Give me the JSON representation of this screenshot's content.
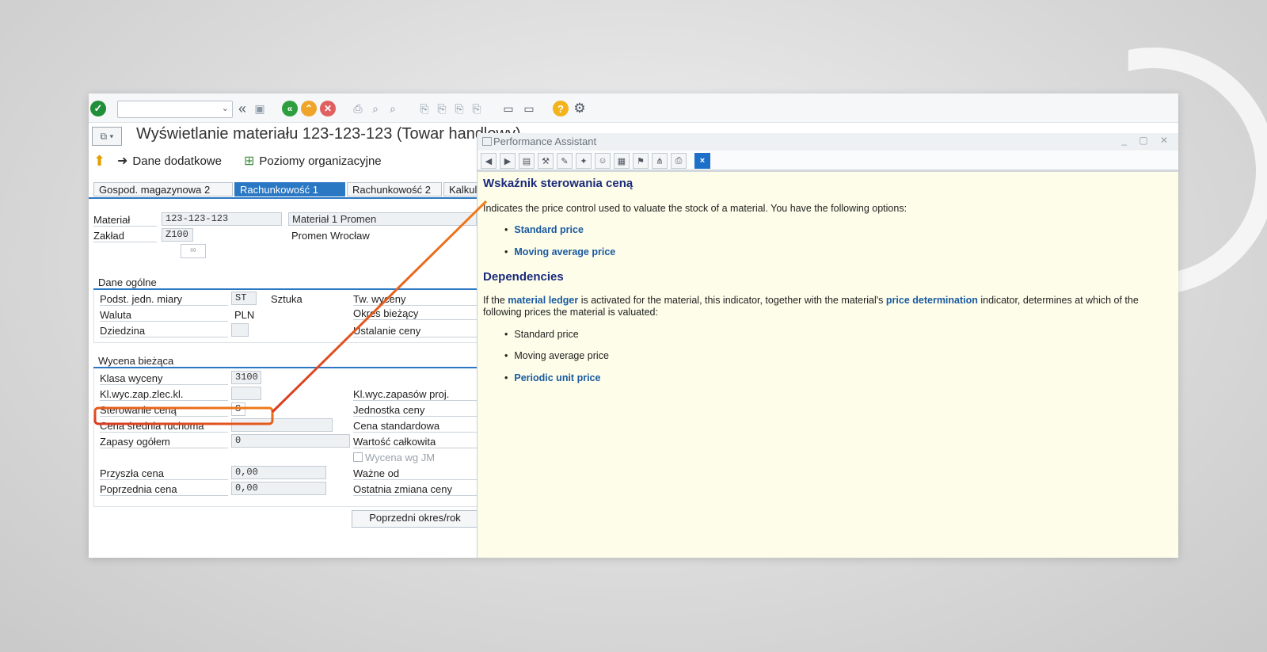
{
  "toolbar": {
    "command_field_value": ""
  },
  "header": {
    "title": "Wyświetlanie materiału 123-123-123 (Towar handlowy)"
  },
  "app_toolbar": {
    "additional_data": "Dane dodatkowe",
    "org_levels": "Poziomy organizacyjne"
  },
  "tabs": [
    {
      "label": "Gospod. magazynowa 2"
    },
    {
      "label": "Rachunkowość 1"
    },
    {
      "label": "Rachunkowość 2"
    },
    {
      "label": "Kalkul"
    }
  ],
  "header_fields": {
    "material_label": "Materiał",
    "material_value": "123-123-123",
    "material_desc": "Materiał 1 Promen",
    "plant_label": "Zakład",
    "plant_value": "Z100",
    "plant_desc": "Promen Wrocław"
  },
  "general_data": {
    "title": "Dane ogólne",
    "base_uom_label": "Podst. jedn. miary",
    "base_uom_value": "ST",
    "base_uom_text": "Sztuka",
    "currency_label": "Waluta",
    "currency_value": "PLN",
    "division_label": "Dziedzina",
    "valuation_type_label": "Tw. wyceny",
    "current_period_label": "Okres bieżący",
    "price_determination_label": "Ustalanie ceny"
  },
  "current_valuation": {
    "title": "Wycena bieżąca",
    "valuation_class_label": "Klasa wyceny",
    "valuation_class_value": "3100",
    "vc_sales_order_label": "Kl.wyc.zap.zlec.kl.",
    "vc_project_label": "Kl.wyc.zapasów proj.",
    "price_control_label": "Sterowanie ceną",
    "price_control_value": "S",
    "price_unit_label": "Jednostka ceny",
    "moving_avg_label": "Cena średnia ruchoma",
    "standard_price_label": "Cena standardowa",
    "total_stock_label": "Zapasy ogółem",
    "total_stock_value": "0",
    "total_value_label": "Wartość całkowita",
    "valuated_uom_label": "Wycena wg JM",
    "future_price_label": "Przyszła cena",
    "future_price_value": "0,00",
    "valid_from_label": "Ważne od",
    "previous_price_label": "Poprzednia cena",
    "previous_price_value": "0,00",
    "last_price_change_label": "Ostatnia zmiana ceny",
    "prev_period_button": "Poprzedni okres/rok"
  },
  "performance_assistant": {
    "window_title": "Performance Assistant",
    "heading": "Wskaźnik sterowania ceną",
    "intro": "Indicates the price control used to valuate the stock of a material. You have the following options:",
    "options": [
      "Standard price",
      "Moving average price"
    ],
    "dependencies_heading": "Dependencies",
    "dep_text_1": "If the ",
    "dep_link_1": "material ledger",
    "dep_text_2": " is activated for the material, this indicator, together with the material's ",
    "dep_link_2": "price determination",
    "dep_text_3": " indicator, determines at which of the following prices the material is valuated:",
    "dep_items": [
      "Standard price",
      "Moving average price"
    ],
    "dep_link_item": "Periodic unit price"
  },
  "colors": {
    "accent_blue": "#2a77c3",
    "callout_orange": "#f07d1a",
    "callout_red": "#d93a20",
    "help_bg": "#fdfdea",
    "heading_navy": "#1b2b7a",
    "link_blue": "#1a5aa0"
  }
}
